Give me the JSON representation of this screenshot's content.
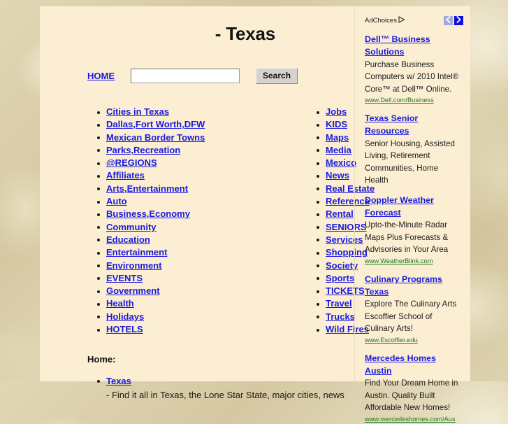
{
  "page": {
    "title": "- Texas",
    "home_link": "HOME",
    "search": {
      "value": "",
      "placeholder": "",
      "button_label": "Search"
    },
    "home_section": {
      "heading": "Home:",
      "entry_link": "Texas",
      "entry_desc": " - Find it all in Texas, the Lone Star State, major cities, news"
    }
  },
  "categories": {
    "left": [
      "Cities in Texas",
      "Dallas,Fort Worth,DFW",
      "Mexican Border Towns",
      "Parks,Recreation",
      "@REGIONS",
      "Affiliates",
      "Arts,Entertainment",
      "Auto",
      "Business,Economy",
      "Community",
      "Education",
      "Entertainment",
      "Environment",
      "EVENTS",
      "Government",
      "Health",
      "Holidays",
      "HOTELS"
    ],
    "right": [
      "Jobs",
      "KIDS",
      "Maps",
      "Media",
      "Mexico",
      "News",
      "Real Estate",
      "Reference",
      "Rental",
      "SENIORS",
      "Services",
      "Shopping",
      "Society",
      "Sports",
      "TICKETS",
      "Travel",
      "Trucks",
      "Wild Fires"
    ]
  },
  "ads": {
    "adchoices_label": "AdChoices",
    "prev_label": "‹",
    "next_label": "›",
    "items": [
      {
        "title": "Dell™ Business Solutions",
        "desc": "Purchase Business Computers w/ 2010 Intel® Core™ at Dell™ Online.",
        "url": "www.Dell.com/Business"
      },
      {
        "title": "Texas Senior Resources",
        "desc": "Senior Housing, Assisted Living, Retirement Communities, Home Health",
        "url": ""
      },
      {
        "title": "Doppler Weather Forecast",
        "desc": "Upto-the-Minute Radar Maps Plus Forecasts & Advisories in Your Area",
        "url": "www.WeatherBlink.com"
      },
      {
        "title": "Culinary Programs Texas",
        "desc": "Explore The Culinary Arts Escoffier School of Culinary Arts!",
        "url": "www.Escoffier.edu"
      },
      {
        "title": "Mercedes Homes Austin",
        "desc": "Find Your Dream Home in Austin. Quality Built Affordable New Homes!",
        "url": "www.mercedeshomes.com/Aus"
      }
    ]
  },
  "colors": {
    "link_blue": "#1a1ae0",
    "panel_bg": "#fbeed2",
    "page_bg": "#d8cba6",
    "url_green": "#1c7a1c",
    "ad_next_blue": "#1111dd",
    "ad_prev_blue": "#a8a8dd"
  }
}
